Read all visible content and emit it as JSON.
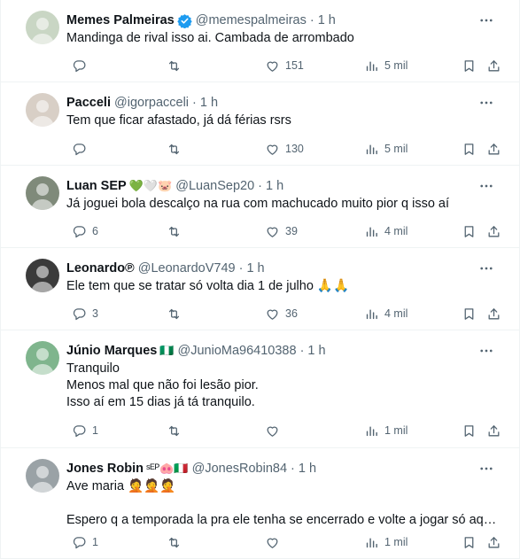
{
  "tweets": [
    {
      "name": "Memes Palmeiras",
      "verified": true,
      "emojis": "",
      "handle": "@memespalmeiras",
      "time": "1 h",
      "lines": [
        "Mandinga de rival isso ai. Cambada de arrombado"
      ],
      "replies": "",
      "likes": "151",
      "views": "5 mil",
      "avatar_color": "#c9d6c4",
      "icons": [
        "reply-icon",
        "retweet-icon",
        "like-icon",
        "views-icon",
        "bookmark-icon",
        "share-icon"
      ]
    },
    {
      "name": "Pacceli",
      "verified": false,
      "emojis": "",
      "handle": "@igorpacceli",
      "time": "1 h",
      "lines": [
        "Tem que ficar afastado, já dá férias rsrs"
      ],
      "replies": "",
      "likes": "130",
      "views": "5 mil",
      "avatar_color": "#d8cfc6"
    },
    {
      "name": "Luan SEP",
      "verified": false,
      "emojis": "💚🤍🐷",
      "handle": "@LuanSep20",
      "time": "1 h",
      "lines": [
        "Já joguei bola descalço na rua com machucado muito pior q isso aí"
      ],
      "replies": "6",
      "likes": "39",
      "views": "4 mil",
      "avatar_color": "#7f8a7a"
    },
    {
      "name": "Leonardo℗",
      "verified": false,
      "emojis": "",
      "handle": "@LeonardoV749",
      "time": "1 h",
      "lines": [
        "Ele tem que se tratar só volta dia 1 de julho 🙏🙏"
      ],
      "replies": "3",
      "likes": "36",
      "views": "4 mil",
      "avatar_color": "#3b3b3b"
    },
    {
      "name": "Júnio Marques",
      "verified": false,
      "emojis": "🇳🇬",
      "handle": "@JunioMa96410388",
      "time": "1 h",
      "lines": [
        "Tranquilo",
        "Menos mal que não foi lesão pior.",
        "Isso aí em 15 dias já tá tranquilo."
      ],
      "replies": "1",
      "likes": "",
      "views": "1 mil",
      "avatar_color": "#7fb58d"
    },
    {
      "name": "Jones Robin",
      "verified": false,
      "emojis": "ˢᴱᴾ🐽🇮🇹",
      "handle": "@JonesRobin84",
      "time": "1 h",
      "lines": [
        "Ave maria 🤦🤦🤦",
        "",
        "Espero q a temporada la pra ele tenha se encerrado e volte a jogar só aqui..."
      ],
      "replies": "1",
      "likes": "",
      "views": "1 mil",
      "avatar_color": "#9aa2a6"
    }
  ],
  "colors": {
    "text": "#0f1419",
    "secondary": "#536471",
    "verified": "#1d9bf0",
    "divider": "#eff3f4"
  }
}
